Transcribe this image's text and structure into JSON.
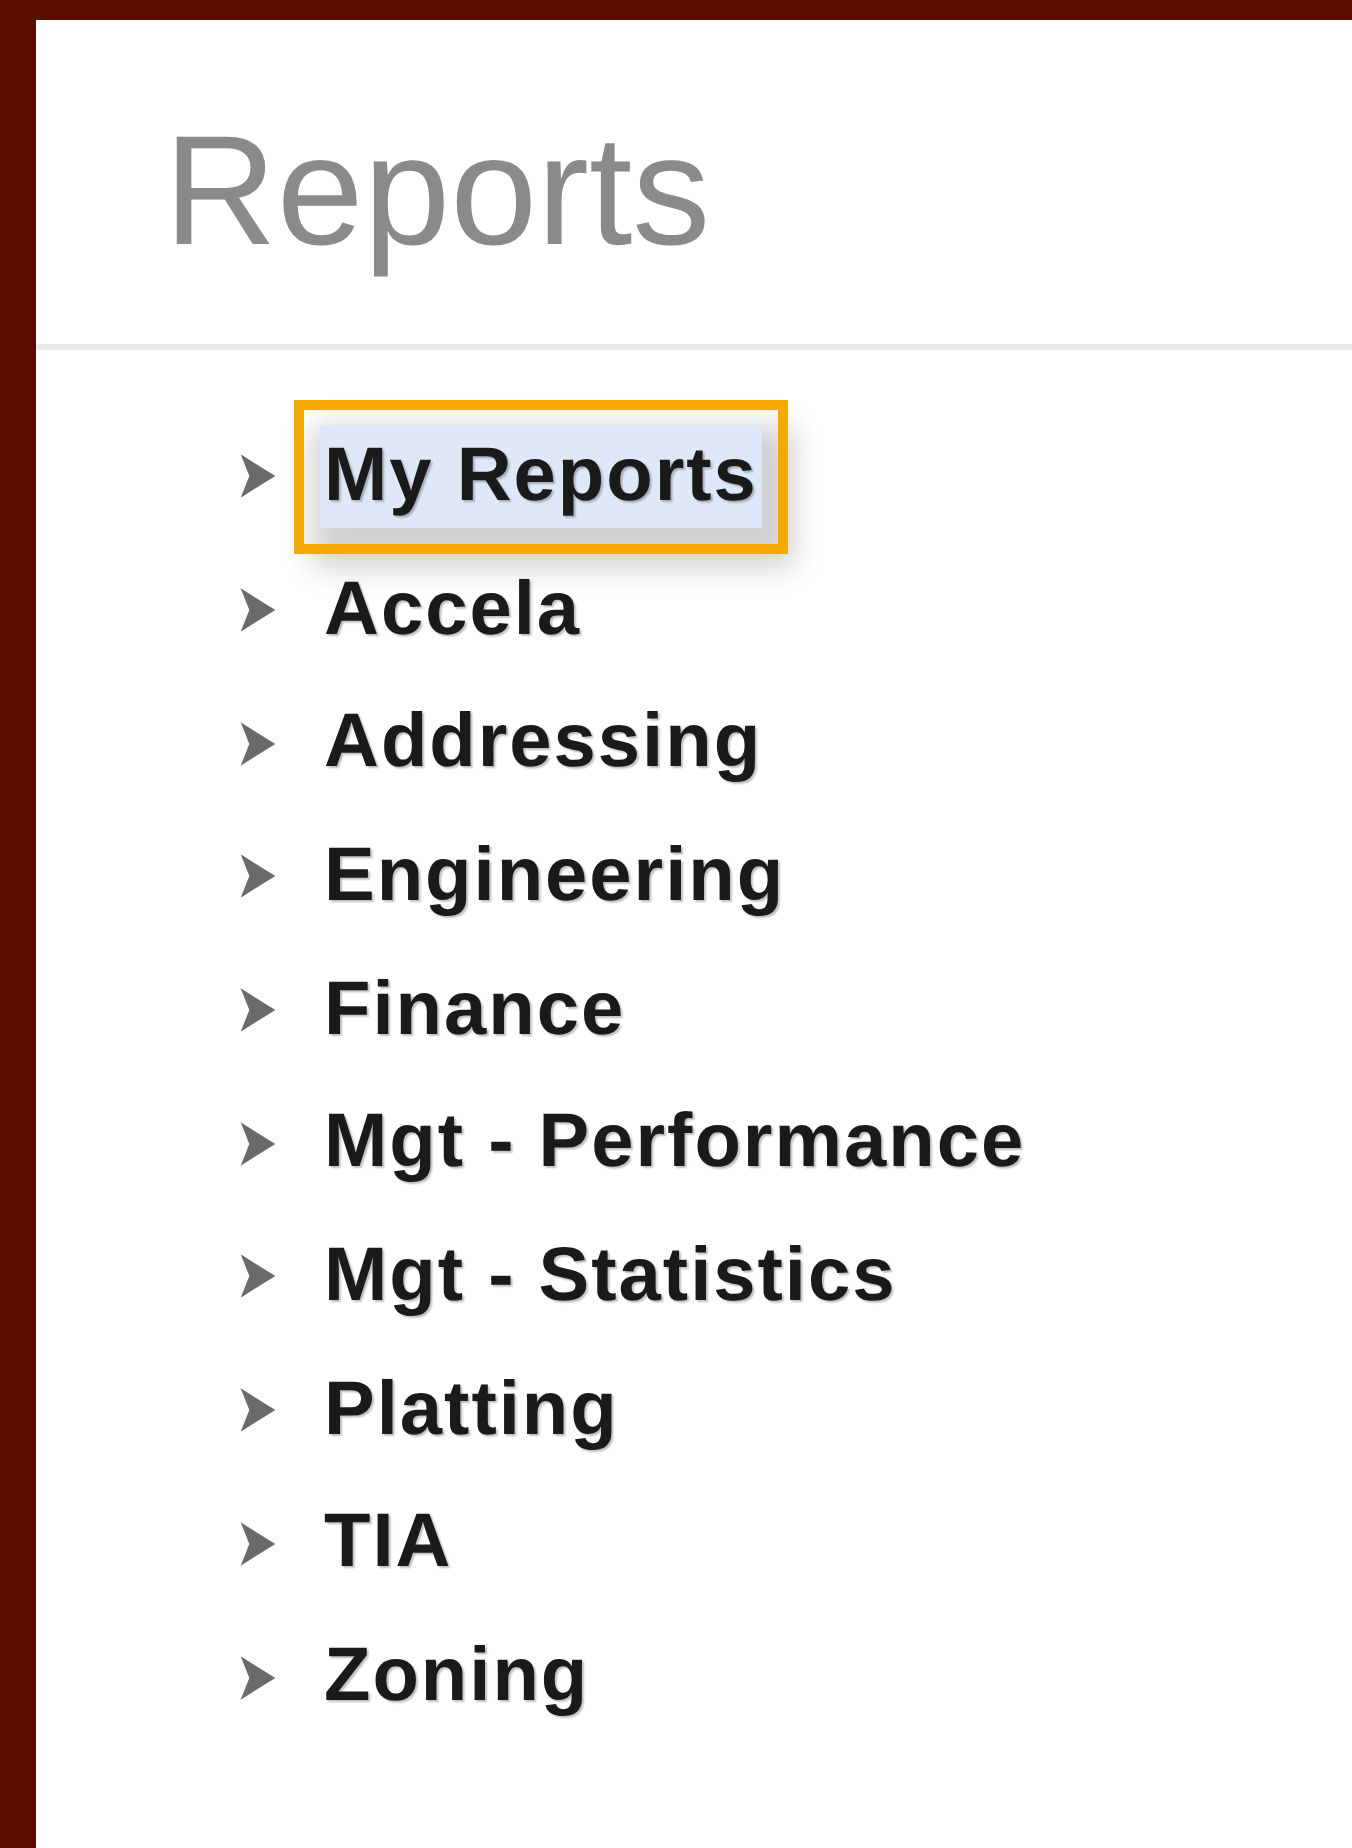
{
  "header": {
    "title": "Reports"
  },
  "tree": {
    "items": [
      {
        "label": "My Reports",
        "selected": true,
        "expanded": false
      },
      {
        "label": "Accela",
        "selected": false,
        "expanded": false
      },
      {
        "label": "Addressing",
        "selected": false,
        "expanded": false
      },
      {
        "label": "Engineering",
        "selected": false,
        "expanded": false
      },
      {
        "label": "Finance",
        "selected": false,
        "expanded": false
      },
      {
        "label": "Mgt - Performance",
        "selected": false,
        "expanded": false
      },
      {
        "label": "Mgt - Statistics",
        "selected": false,
        "expanded": false
      },
      {
        "label": "Platting",
        "selected": false,
        "expanded": false
      },
      {
        "label": "TIA",
        "selected": false,
        "expanded": false
      },
      {
        "label": "Zoning",
        "selected": false,
        "expanded": false
      }
    ]
  }
}
